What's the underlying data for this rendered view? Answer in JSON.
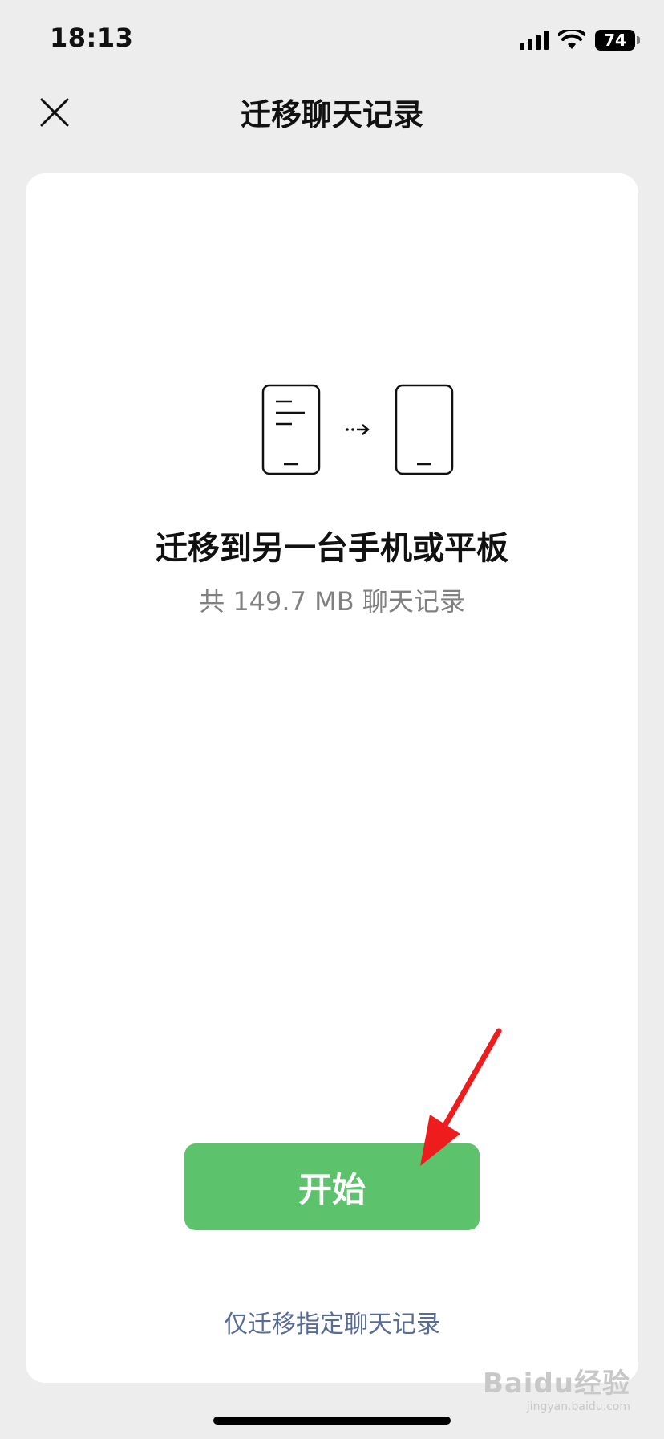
{
  "status_bar": {
    "time": "18:13",
    "battery_level": "74",
    "icons": [
      "signal-icon",
      "wifi-icon",
      "battery-icon"
    ]
  },
  "nav": {
    "title": "迁移聊天记录",
    "close_icon": "close-icon"
  },
  "main": {
    "illustration_icons": [
      "source-phone-icon",
      "transfer-arrow-icon",
      "target-phone-icon"
    ],
    "heading": "迁移到另一台手机或平板",
    "subtext": "共 149.7 MB 聊天记录",
    "start_button_label": "开始",
    "selective_link_label": "仅迁移指定聊天记录"
  },
  "watermark": {
    "brand": "Baidu经验",
    "url": "jingyan.baidu.com"
  },
  "colors": {
    "background": "#ededed",
    "card": "#ffffff",
    "primary_green": "#5cc36c",
    "link_blue": "#576b95",
    "annotation_red": "#ee1c1c"
  }
}
